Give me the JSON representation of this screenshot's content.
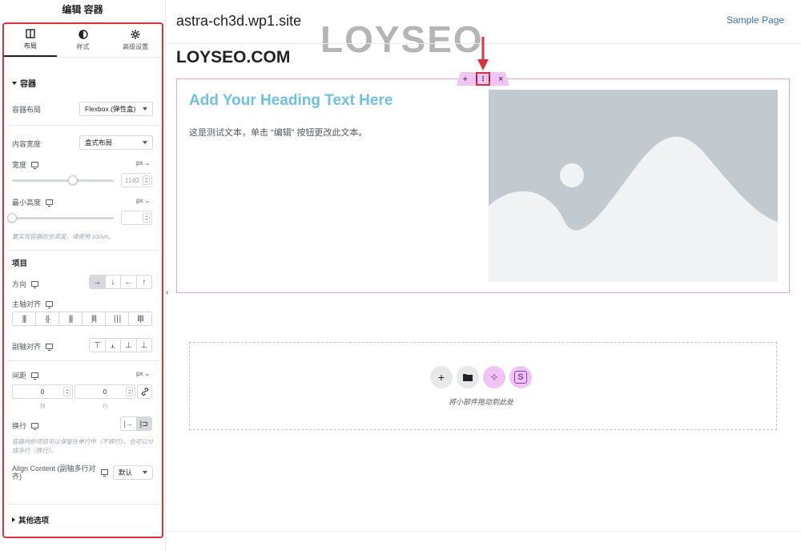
{
  "panel": {
    "title": "编辑 容器",
    "tabs": [
      {
        "label": "布局",
        "icon": "layout-icon"
      },
      {
        "label": "样式",
        "icon": "contrast-icon"
      },
      {
        "label": "高级设置",
        "icon": "gear-icon"
      }
    ],
    "section_container": "容器",
    "container_layout_label": "容器布局",
    "container_layout_value": "Flexbox (弹性盒)",
    "content_width_label": "内容宽度",
    "content_width_value": "盒式布局",
    "width_label": "宽度",
    "width_unit": "px",
    "width_value": "1140",
    "width_fraction": 0.6,
    "min_height_label": "最小高度",
    "min_height_unit": "px",
    "min_height_value": "",
    "min_height_hint": "要实现容器的全高度，请使用 100vh。",
    "section_items": "项目",
    "direction_label": "方向",
    "direction_options": [
      "→",
      "↓",
      "←",
      "↑"
    ],
    "main_align_label": "主轴对齐",
    "main_align_options": [
      "|||",
      "·||·",
      "|||",
      "|‖|",
      "| | |",
      "‖|‖"
    ],
    "cross_align_label": "副轴对齐",
    "cross_align_options": [
      "⊤",
      "⫠",
      "⊥",
      "⊥"
    ],
    "gap_label": "间距",
    "gap_unit": "px",
    "gap_column_value": "0",
    "gap_row_value": "0",
    "gap_column_label": "列",
    "gap_row_label": "行",
    "wrap_label": "换行",
    "wrap_hint": "容器内的项目可以保留在单行中（不换行），也可以分成多行（换行）。",
    "align_content_label": "Align Content (副轴多行对齐)",
    "align_content_value": "默认",
    "section_other": "其他选项"
  },
  "canvas": {
    "site_title": "astra-ch3d.wp1.site",
    "nav_link": "Sample Page",
    "watermark": "LOYSEO",
    "brand": "LOYSEO.COM",
    "container_handle": {
      "add": "+",
      "drag": "⋮⋮⋮",
      "close": "×"
    },
    "heading": "Add Your Heading Text Here",
    "paragraph": "这是测试文本，单击 “编辑” 按钮更改此文本。",
    "drop_zone_text": "将小部件拖动到此处",
    "drop_buttons": {
      "add": "+",
      "folder": "▪",
      "ai": "✧",
      "s": "S"
    }
  },
  "colors": {
    "accent_red": "#d9333f",
    "container_border": "#e9a2ee",
    "handle_bg": "#f2c3f5",
    "heading": "#6ec1e4",
    "link": "#3a71b7"
  }
}
